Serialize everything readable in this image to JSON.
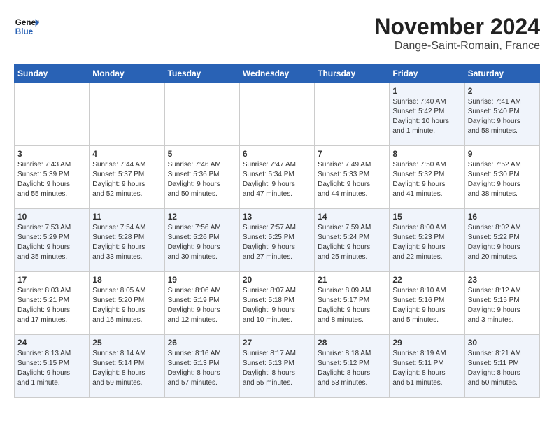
{
  "header": {
    "logo_line1": "General",
    "logo_line2": "Blue",
    "month": "November 2024",
    "location": "Dange-Saint-Romain, France"
  },
  "columns": [
    "Sunday",
    "Monday",
    "Tuesday",
    "Wednesday",
    "Thursday",
    "Friday",
    "Saturday"
  ],
  "weeks": [
    [
      {
        "day": "",
        "info": ""
      },
      {
        "day": "",
        "info": ""
      },
      {
        "day": "",
        "info": ""
      },
      {
        "day": "",
        "info": ""
      },
      {
        "day": "",
        "info": ""
      },
      {
        "day": "1",
        "info": "Sunrise: 7:40 AM\nSunset: 5:42 PM\nDaylight: 10 hours\nand 1 minute."
      },
      {
        "day": "2",
        "info": "Sunrise: 7:41 AM\nSunset: 5:40 PM\nDaylight: 9 hours\nand 58 minutes."
      }
    ],
    [
      {
        "day": "3",
        "info": "Sunrise: 7:43 AM\nSunset: 5:39 PM\nDaylight: 9 hours\nand 55 minutes."
      },
      {
        "day": "4",
        "info": "Sunrise: 7:44 AM\nSunset: 5:37 PM\nDaylight: 9 hours\nand 52 minutes."
      },
      {
        "day": "5",
        "info": "Sunrise: 7:46 AM\nSunset: 5:36 PM\nDaylight: 9 hours\nand 50 minutes."
      },
      {
        "day": "6",
        "info": "Sunrise: 7:47 AM\nSunset: 5:34 PM\nDaylight: 9 hours\nand 47 minutes."
      },
      {
        "day": "7",
        "info": "Sunrise: 7:49 AM\nSunset: 5:33 PM\nDaylight: 9 hours\nand 44 minutes."
      },
      {
        "day": "8",
        "info": "Sunrise: 7:50 AM\nSunset: 5:32 PM\nDaylight: 9 hours\nand 41 minutes."
      },
      {
        "day": "9",
        "info": "Sunrise: 7:52 AM\nSunset: 5:30 PM\nDaylight: 9 hours\nand 38 minutes."
      }
    ],
    [
      {
        "day": "10",
        "info": "Sunrise: 7:53 AM\nSunset: 5:29 PM\nDaylight: 9 hours\nand 35 minutes."
      },
      {
        "day": "11",
        "info": "Sunrise: 7:54 AM\nSunset: 5:28 PM\nDaylight: 9 hours\nand 33 minutes."
      },
      {
        "day": "12",
        "info": "Sunrise: 7:56 AM\nSunset: 5:26 PM\nDaylight: 9 hours\nand 30 minutes."
      },
      {
        "day": "13",
        "info": "Sunrise: 7:57 AM\nSunset: 5:25 PM\nDaylight: 9 hours\nand 27 minutes."
      },
      {
        "day": "14",
        "info": "Sunrise: 7:59 AM\nSunset: 5:24 PM\nDaylight: 9 hours\nand 25 minutes."
      },
      {
        "day": "15",
        "info": "Sunrise: 8:00 AM\nSunset: 5:23 PM\nDaylight: 9 hours\nand 22 minutes."
      },
      {
        "day": "16",
        "info": "Sunrise: 8:02 AM\nSunset: 5:22 PM\nDaylight: 9 hours\nand 20 minutes."
      }
    ],
    [
      {
        "day": "17",
        "info": "Sunrise: 8:03 AM\nSunset: 5:21 PM\nDaylight: 9 hours\nand 17 minutes."
      },
      {
        "day": "18",
        "info": "Sunrise: 8:05 AM\nSunset: 5:20 PM\nDaylight: 9 hours\nand 15 minutes."
      },
      {
        "day": "19",
        "info": "Sunrise: 8:06 AM\nSunset: 5:19 PM\nDaylight: 9 hours\nand 12 minutes."
      },
      {
        "day": "20",
        "info": "Sunrise: 8:07 AM\nSunset: 5:18 PM\nDaylight: 9 hours\nand 10 minutes."
      },
      {
        "day": "21",
        "info": "Sunrise: 8:09 AM\nSunset: 5:17 PM\nDaylight: 9 hours\nand 8 minutes."
      },
      {
        "day": "22",
        "info": "Sunrise: 8:10 AM\nSunset: 5:16 PM\nDaylight: 9 hours\nand 5 minutes."
      },
      {
        "day": "23",
        "info": "Sunrise: 8:12 AM\nSunset: 5:15 PM\nDaylight: 9 hours\nand 3 minutes."
      }
    ],
    [
      {
        "day": "24",
        "info": "Sunrise: 8:13 AM\nSunset: 5:15 PM\nDaylight: 9 hours\nand 1 minute."
      },
      {
        "day": "25",
        "info": "Sunrise: 8:14 AM\nSunset: 5:14 PM\nDaylight: 8 hours\nand 59 minutes."
      },
      {
        "day": "26",
        "info": "Sunrise: 8:16 AM\nSunset: 5:13 PM\nDaylight: 8 hours\nand 57 minutes."
      },
      {
        "day": "27",
        "info": "Sunrise: 8:17 AM\nSunset: 5:13 PM\nDaylight: 8 hours\nand 55 minutes."
      },
      {
        "day": "28",
        "info": "Sunrise: 8:18 AM\nSunset: 5:12 PM\nDaylight: 8 hours\nand 53 minutes."
      },
      {
        "day": "29",
        "info": "Sunrise: 8:19 AM\nSunset: 5:11 PM\nDaylight: 8 hours\nand 51 minutes."
      },
      {
        "day": "30",
        "info": "Sunrise: 8:21 AM\nSunset: 5:11 PM\nDaylight: 8 hours\nand 50 minutes."
      }
    ]
  ]
}
